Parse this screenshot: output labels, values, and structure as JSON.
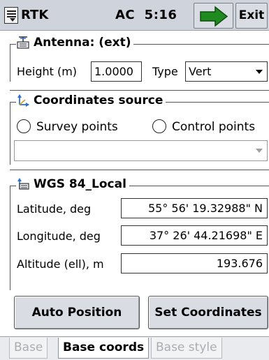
{
  "titlebar": {
    "app_title": "RTK",
    "status": "AC  5:16",
    "exit_label": "Exit",
    "go_icon": "green-right-arrow-icon",
    "menu_icon": "menu-icon"
  },
  "antenna": {
    "title": "Antenna: (ext)",
    "height_label": "Height (m)",
    "height_value": "1.0000",
    "type_label": "Type",
    "type_value": "Vert"
  },
  "coordinates_source": {
    "title": "Coordinates source",
    "option_survey": "Survey points",
    "option_control": "Control points",
    "selected_point": ""
  },
  "wgs": {
    "title": "WGS 84_Local",
    "latitude_label": "Latitude, deg",
    "latitude_value": "55° 56' 19.32988\" N",
    "longitude_label": "Longitude, deg",
    "longitude_value": "37° 26' 44.21698\" E",
    "altitude_label": "Altitude (ell), m",
    "altitude_value": "193.676"
  },
  "buttons": {
    "auto_position": "Auto Position",
    "set_coordinates": "Set Coordinates"
  },
  "tabs": [
    {
      "label": "Base",
      "active": false
    },
    {
      "label": "Base coords",
      "active": true
    },
    {
      "label": "Base style",
      "active": false
    }
  ],
  "colors": {
    "arrow_green": "#1f8a1f",
    "titlebar_bg": "#cfd4dc"
  }
}
